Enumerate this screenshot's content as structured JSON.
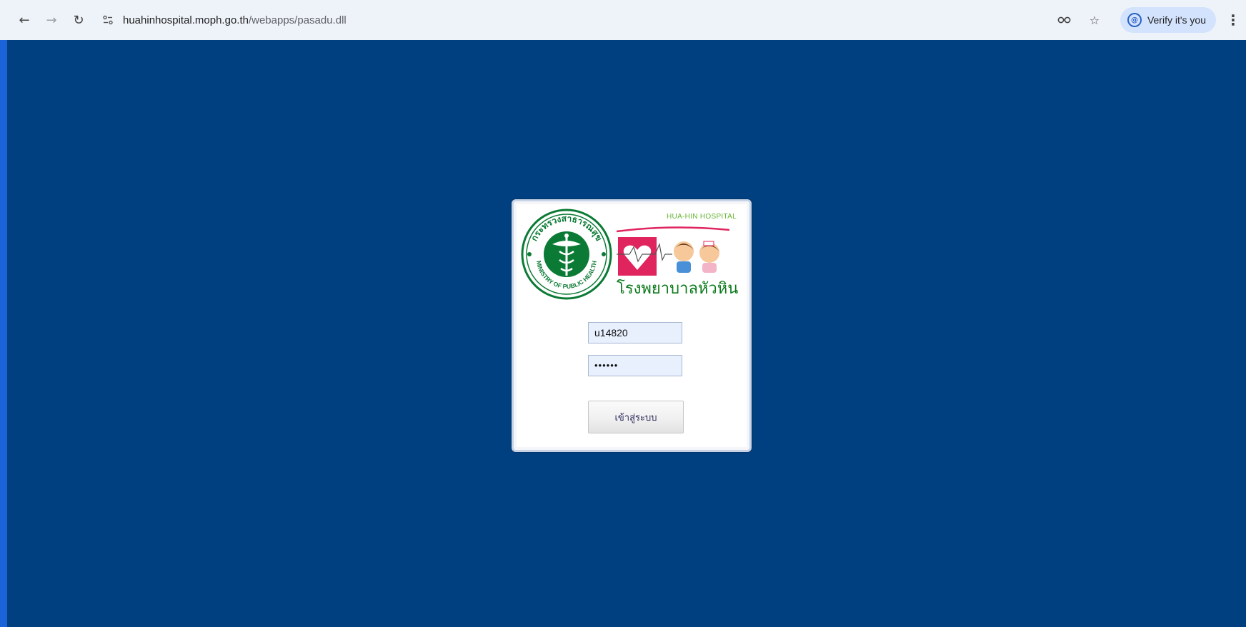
{
  "browser": {
    "url_host": "huahinhospital.moph.go.th",
    "url_path": "/webapps/pasadu.dll",
    "verify_label": "Verify it's you",
    "icons": [
      "back-arrow-icon",
      "forward-arrow-icon",
      "reload-icon",
      "site-info-icon",
      "key-icon",
      "star-icon",
      "verify-identity-icon",
      "kebab-menu-icon"
    ]
  },
  "login": {
    "moph_seal_top_text": "กระทรวงสาธารณสุข",
    "moph_seal_bottom_text": "MINISTRY OF PUBLIC HEALTH",
    "hospital_name_en": "HUA-HIN HOSPITAL",
    "hospital_name_th": "โรงพยาบาลหัวหิน",
    "username_value": "u14820",
    "password_value": "••••••",
    "submit_label": "เข้าสู่ระบบ"
  },
  "colors": {
    "page_background": "#004080",
    "moph_green": "#0a7a34",
    "hospital_green": "#0c7a1c",
    "heart_red": "#e0245e",
    "field_fill": "#e8f0fe"
  }
}
